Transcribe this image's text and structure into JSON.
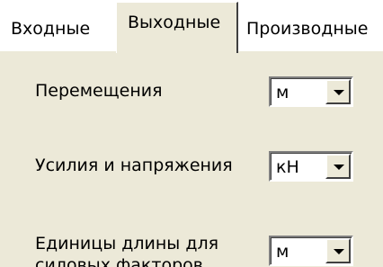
{
  "tabs": [
    {
      "label": "Входные"
    },
    {
      "label": "Выходные"
    },
    {
      "label": "Производные"
    }
  ],
  "active_tab": "Выходные",
  "rows": [
    {
      "label": "Перемещения",
      "value": "м"
    },
    {
      "label": "Усилия и напряжения",
      "value": "кН"
    },
    {
      "label_line1": "Единицы длины для",
      "label_line2": "силовых факторов",
      "value": "м"
    }
  ],
  "icons": {
    "dropdown": "chevron-down-icon"
  }
}
